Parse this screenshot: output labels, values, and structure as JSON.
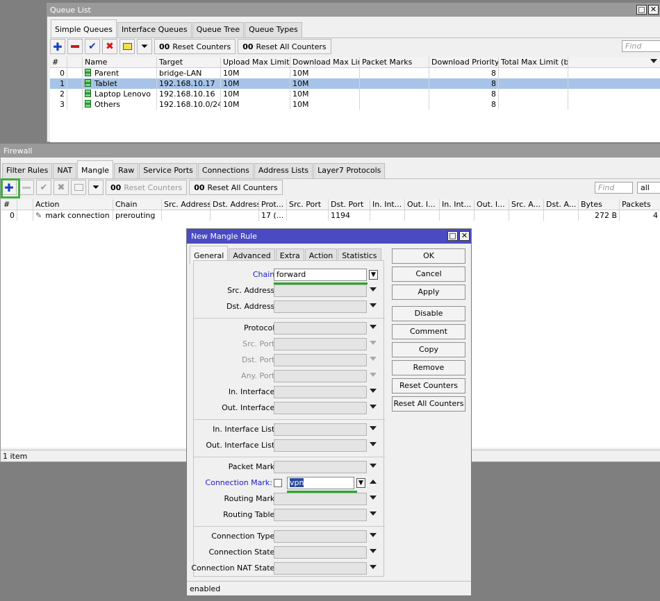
{
  "colors": {
    "selected_row": "#a7c4e8",
    "dialog_title": "#4a4ac2",
    "highlight": "#3ab13a",
    "link_label": "#1b1bc4"
  },
  "queue": {
    "title": "Queue List",
    "tabs": [
      "Simple Queues",
      "Interface Queues",
      "Queue Tree",
      "Queue Types"
    ],
    "reset_counters": "Reset Counters",
    "reset_all_counters": "Reset All Counters",
    "counter_prefix": "00",
    "find_placeholder": "Find",
    "columns": [
      "#",
      "",
      "Name",
      "Target",
      "Upload Max Limit",
      "Download Max Limit",
      "Packet Marks",
      "Download Priority",
      "Total Max Limit (b...",
      ""
    ],
    "rows": [
      {
        "num": "0",
        "name": "Parent",
        "target": "bridge-LAN",
        "up": "10M",
        "down": "10M",
        "marks": "",
        "prio": "8",
        "total": "",
        "selected": false
      },
      {
        "num": "1",
        "name": "Tablet",
        "target": "192.168.10.17",
        "up": "10M",
        "down": "10M",
        "marks": "",
        "prio": "8",
        "total": "",
        "selected": true
      },
      {
        "num": "2",
        "name": "Laptop Lenovo",
        "target": "192.168.10.16",
        "up": "10M",
        "down": "10M",
        "marks": "",
        "prio": "8",
        "total": "",
        "selected": false
      },
      {
        "num": "3",
        "name": "Others",
        "target": "192.168.10.0/24",
        "up": "10M",
        "down": "10M",
        "marks": "",
        "prio": "8",
        "total": "",
        "selected": false
      }
    ]
  },
  "firewall": {
    "title": "Firewall",
    "tabs": [
      "Filter Rules",
      "NAT",
      "Mangle",
      "Raw",
      "Service Ports",
      "Connections",
      "Address Lists",
      "Layer7 Protocols"
    ],
    "reset_counters": "Reset Counters",
    "reset_all_counters": "Reset All Counters",
    "counter_prefix": "00",
    "find_placeholder": "Find",
    "filter_select": "all",
    "columns": [
      "#",
      "",
      "Action",
      "Chain",
      "Src. Address",
      "Dst. Address",
      "Prot...",
      "Src. Port",
      "Dst. Port",
      "In. Int...",
      "Out. I...",
      "In. Int...",
      "Out. I...",
      "Src. A...",
      "Dst. A...",
      "Bytes",
      "Packets"
    ],
    "rows": [
      {
        "num": "0",
        "action": "mark connection",
        "chain": "prerouting",
        "src": "",
        "dst": "",
        "proto": "17 (...",
        "sport": "",
        "dport": "1194",
        "bytes": "272 B",
        "packets": "4"
      }
    ],
    "status": "1 item"
  },
  "dialog": {
    "title": "New Mangle Rule",
    "tabs": [
      "General",
      "Advanced",
      "Extra",
      "Action",
      "Statistics"
    ],
    "fields": {
      "chain": {
        "label": "Chain:",
        "value": "forward"
      },
      "src_address": {
        "label": "Src. Address:"
      },
      "dst_address": {
        "label": "Dst. Address:"
      },
      "protocol": {
        "label": "Protocol:"
      },
      "src_port": {
        "label": "Src. Port:"
      },
      "dst_port": {
        "label": "Dst. Port:"
      },
      "any_port": {
        "label": "Any. Port:"
      },
      "in_interface": {
        "label": "In. Interface:"
      },
      "out_interface": {
        "label": "Out. Interface:"
      },
      "in_interface_list": {
        "label": "In. Interface List:"
      },
      "out_interface_list": {
        "label": "Out. Interface List:"
      },
      "packet_mark": {
        "label": "Packet Mark:"
      },
      "connection_mark": {
        "label": "Connection Mark:",
        "value": "vpn"
      },
      "routing_mark": {
        "label": "Routing Mark:"
      },
      "routing_table": {
        "label": "Routing Table:"
      },
      "connection_type": {
        "label": "Connection Type:"
      },
      "connection_state": {
        "label": "Connection State:"
      },
      "connection_nat_state": {
        "label": "Connection NAT State:"
      }
    },
    "buttons": [
      "OK",
      "Cancel",
      "Apply",
      "Disable",
      "Comment",
      "Copy",
      "Remove",
      "Reset Counters",
      "Reset All Counters"
    ],
    "status": "enabled"
  }
}
